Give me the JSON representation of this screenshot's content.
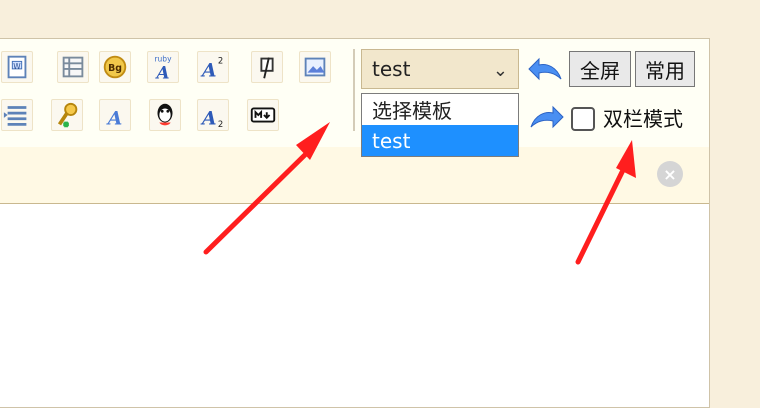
{
  "toolbar": {
    "icons_row1": [
      "word-icon",
      "table-icon",
      "bg-icon",
      "ruby-icon",
      "superscript-icon",
      "clear-format-icon",
      "image-icon"
    ],
    "icons_row2": [
      "list-icon",
      "key-icon",
      "font-icon",
      "qq-icon",
      "subscript-icon",
      "markdown-icon"
    ],
    "template_select": {
      "selected": "test",
      "options": [
        "选择模板",
        "test"
      ]
    },
    "buttons": {
      "fullscreen": "全屏",
      "common": "常用"
    },
    "two_column": {
      "label": "双栏模式",
      "checked": false
    }
  },
  "colors": {
    "selection": "#1e90ff",
    "arrow": "#ff1e1e"
  }
}
